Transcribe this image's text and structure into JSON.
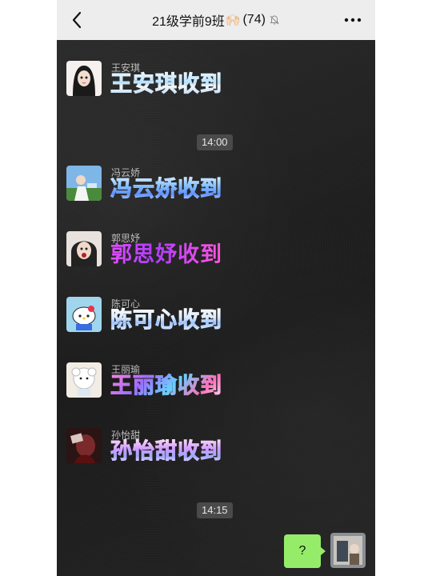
{
  "header": {
    "back_icon": "chevron-left-icon",
    "group_name": "21级学前9班",
    "emoji": "🙌🏻",
    "member_count": "(74)",
    "mute_icon": "bell-off-icon",
    "more_icon": "more-dots-icon"
  },
  "messages": [
    {
      "sender": "王安琪",
      "text": "王安琪收到",
      "style": "ice"
    },
    {
      "sender": "冯云娇",
      "text": "冯云娇收到",
      "style": "blue"
    },
    {
      "sender": "郭思妤",
      "text": "郭思妤收到",
      "style": "purple"
    },
    {
      "sender": "陈可心",
      "text": "陈可心收到",
      "style": "silver"
    },
    {
      "sender": "王丽瑜",
      "text": "王丽瑜收到",
      "style": "galaxy"
    },
    {
      "sender": "孙怡甜",
      "text": "孙怡甜收到",
      "style": "pink"
    }
  ],
  "timestamps": [
    "14:00",
    "14:15"
  ],
  "my_message": {
    "text": "?"
  },
  "colors": {
    "header_bg": "#ededed",
    "chat_bg": "#1f1f1f",
    "my_bubble": "#95ec69",
    "timestamp_bg": "#4a4a4a"
  }
}
